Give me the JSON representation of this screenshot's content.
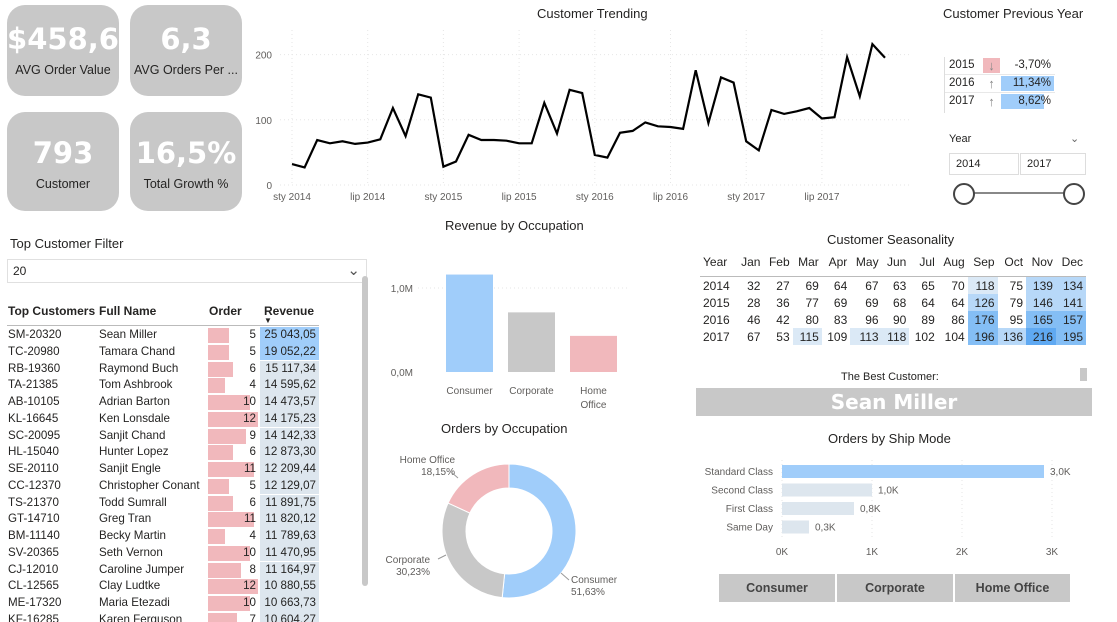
{
  "kpis": {
    "avg_order_value": {
      "value": "$458,6",
      "label": "AVG Order Value"
    },
    "avg_orders_per": {
      "value": "6,3",
      "label": "AVG Orders Per ..."
    },
    "customer": {
      "value": "793",
      "label": "Customer"
    },
    "total_growth": {
      "value": "16,5%",
      "label": "Total Growth %"
    }
  },
  "trending": {
    "title": "Customer Trending",
    "y_ticks": [
      "200",
      "100",
      "0"
    ],
    "x_ticks": [
      "sty 2014",
      "lip 2014",
      "sty 2015",
      "lip 2015",
      "sty 2016",
      "lip 2016",
      "sty 2017",
      "lip 2017"
    ]
  },
  "chart_data": [
    {
      "type": "line",
      "title": "Customer Trending",
      "ylim": [
        0,
        230
      ],
      "x": [
        "2014-01",
        "2014-02",
        "2014-03",
        "2014-04",
        "2014-05",
        "2014-06",
        "2014-07",
        "2014-08",
        "2014-09",
        "2014-10",
        "2014-11",
        "2014-12",
        "2015-01",
        "2015-02",
        "2015-03",
        "2015-04",
        "2015-05",
        "2015-06",
        "2015-07",
        "2015-08",
        "2015-09",
        "2015-10",
        "2015-11",
        "2015-12",
        "2016-01",
        "2016-02",
        "2016-03",
        "2016-04",
        "2016-05",
        "2016-06",
        "2016-07",
        "2016-08",
        "2016-09",
        "2016-10",
        "2016-11",
        "2016-12",
        "2017-01",
        "2017-02",
        "2017-03",
        "2017-04",
        "2017-05",
        "2017-06",
        "2017-07",
        "2017-08",
        "2017-09",
        "2017-10",
        "2017-11",
        "2017-12"
      ],
      "values": [
        32,
        27,
        69,
        64,
        67,
        63,
        65,
        70,
        118,
        75,
        139,
        134,
        28,
        36,
        77,
        69,
        69,
        68,
        64,
        64,
        126,
        79,
        146,
        141,
        46,
        42,
        80,
        83,
        96,
        90,
        89,
        86,
        176,
        95,
        165,
        157,
        67,
        53,
        115,
        109,
        113,
        118,
        102,
        104,
        196,
        136,
        216,
        195
      ]
    },
    {
      "type": "bar",
      "title": "Revenue by Occupation",
      "categories": [
        "Consumer",
        "Corporate",
        "Home Office"
      ],
      "values": [
        1.16,
        0.71,
        0.43
      ],
      "y_ticks": [
        "1,0M",
        "0,0M"
      ],
      "colors": [
        "#a0cdfa",
        "#c8c8c8",
        "#f1b8bc"
      ]
    },
    {
      "type": "pie",
      "title": "Orders by Occupation",
      "categories": [
        "Consumer",
        "Corporate",
        "Home Office"
      ],
      "values": [
        51.63,
        30.23,
        18.15
      ],
      "labels": [
        "51,63%",
        "30,23%",
        "18,15%"
      ],
      "colors": [
        "#a0cdfa",
        "#c8c8c8",
        "#f1b8bc"
      ]
    },
    {
      "type": "bar",
      "title": "Orders by Ship Mode",
      "categories": [
        "Standard Class",
        "Second Class",
        "First Class",
        "Same Day"
      ],
      "values": [
        3.0,
        1.0,
        0.8,
        0.3
      ],
      "labels": [
        "3,0K",
        "1,0K",
        "0,8K",
        "0,3K"
      ],
      "x_ticks": [
        "0K",
        "1K",
        "2K",
        "3K"
      ],
      "colors": [
        "#a0cdfa",
        "#dde6ee",
        "#dde6ee",
        "#dde6ee"
      ]
    }
  ],
  "prev_year": {
    "title": "Customer Previous Year",
    "rows": [
      {
        "year": "2015",
        "pct": "-3,70%",
        "dir": "down",
        "frac": 0
      },
      {
        "year": "2016",
        "pct": "11,34%",
        "dir": "up",
        "frac": 0.98
      },
      {
        "year": "2017",
        "pct": "8,62%",
        "dir": "up",
        "frac": 0.8
      }
    ]
  },
  "year_slicer": {
    "label": "Year",
    "from": "2014",
    "to": "2017"
  },
  "top_filter": {
    "title": "Top Customer Filter",
    "value": "20"
  },
  "top_table": {
    "headers": {
      "id": "Top Customers",
      "name": "Full Name",
      "order": "Order",
      "revenue": "Revenue"
    },
    "rows": [
      {
        "id": "SM-20320",
        "name": "Sean Miller",
        "order": 5,
        "revenue": "25 043,05",
        "rev": 25043
      },
      {
        "id": "TC-20980",
        "name": "Tamara Chand",
        "order": 5,
        "revenue": "19 052,22",
        "rev": 19052
      },
      {
        "id": "RB-19360",
        "name": "Raymond Buch",
        "order": 6,
        "revenue": "15 117,34",
        "rev": 15117
      },
      {
        "id": "TA-21385",
        "name": "Tom Ashbrook",
        "order": 4,
        "revenue": "14 595,62",
        "rev": 14596
      },
      {
        "id": "AB-10105",
        "name": "Adrian Barton",
        "order": 10,
        "revenue": "14 473,57",
        "rev": 14474
      },
      {
        "id": "KL-16645",
        "name": "Ken Lonsdale",
        "order": 12,
        "revenue": "14 175,23",
        "rev": 14175
      },
      {
        "id": "SC-20095",
        "name": "Sanjit Chand",
        "order": 9,
        "revenue": "14 142,33",
        "rev": 14142
      },
      {
        "id": "HL-15040",
        "name": "Hunter Lopez",
        "order": 6,
        "revenue": "12 873,30",
        "rev": 12873
      },
      {
        "id": "SE-20110",
        "name": "Sanjit Engle",
        "order": 11,
        "revenue": "12 209,44",
        "rev": 12209
      },
      {
        "id": "CC-12370",
        "name": "Christopher Conant",
        "order": 5,
        "revenue": "12 129,07",
        "rev": 12129
      },
      {
        "id": "TS-21370",
        "name": "Todd Sumrall",
        "order": 6,
        "revenue": "11 891,75",
        "rev": 11892
      },
      {
        "id": "GT-14710",
        "name": "Greg Tran",
        "order": 11,
        "revenue": "11 820,12",
        "rev": 11820
      },
      {
        "id": "BM-11140",
        "name": "Becky Martin",
        "order": 4,
        "revenue": "11 789,63",
        "rev": 11790
      },
      {
        "id": "SV-20365",
        "name": "Seth Vernon",
        "order": 10,
        "revenue": "11 470,95",
        "rev": 11471
      },
      {
        "id": "CJ-12010",
        "name": "Caroline Jumper",
        "order": 8,
        "revenue": "11 164,97",
        "rev": 11165
      },
      {
        "id": "CL-12565",
        "name": "Clay Ludtke",
        "order": 12,
        "revenue": "10 880,55",
        "rev": 10881
      },
      {
        "id": "ME-17320",
        "name": "Maria Etezadi",
        "order": 10,
        "revenue": "10 663,73",
        "rev": 10664
      },
      {
        "id": "KF-16285",
        "name": "Karen Ferguson",
        "order": 7,
        "revenue": "10 604,27",
        "rev": 10604
      }
    ]
  },
  "seasonality": {
    "title": "Customer Seasonality",
    "header": [
      "Year",
      "Jan",
      "Feb",
      "Mar",
      "Apr",
      "May",
      "Jun",
      "Jul",
      "Aug",
      "Sep",
      "Oct",
      "Nov",
      "Dec"
    ],
    "rows": [
      [
        "2014",
        32,
        27,
        69,
        64,
        67,
        63,
        65,
        70,
        118,
        75,
        139,
        134
      ],
      [
        "2015",
        28,
        36,
        77,
        69,
        69,
        68,
        64,
        64,
        126,
        79,
        146,
        141
      ],
      [
        "2016",
        46,
        42,
        80,
        83,
        96,
        90,
        89,
        86,
        176,
        95,
        165,
        157
      ],
      [
        "2017",
        67,
        53,
        115,
        109,
        113,
        118,
        102,
        104,
        196,
        136,
        216,
        195
      ]
    ]
  },
  "best_customer": {
    "label": "The Best Customer:",
    "name": "Sean Miller"
  },
  "occupation_buttons": [
    "Consumer",
    "Corporate",
    "Home Office"
  ]
}
